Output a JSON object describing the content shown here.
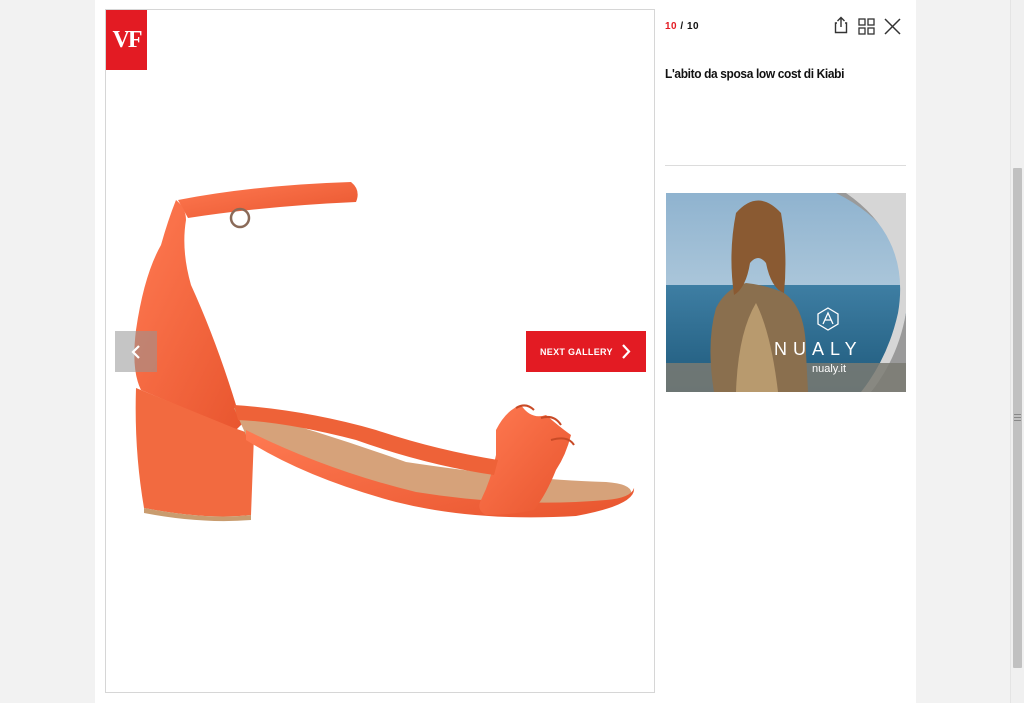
{
  "brand": {
    "logo_text": "VF",
    "accent_color": "#e31b23"
  },
  "gallery": {
    "current": "10",
    "separator": "/",
    "total": "10",
    "title": "L'abito da sposa low cost di Kiabi",
    "next_gallery_label": "NEXT GALLERY"
  },
  "image": {
    "subject": "orange suede block-heel sandal with ankle strap and ruffle"
  },
  "toolbar": {
    "share_icon": "share-icon",
    "grid_icon": "grid-icon",
    "close_icon": "close-icon"
  },
  "ad": {
    "brand": "NUALY",
    "url": "nualy.it",
    "logo_letter": "A"
  }
}
